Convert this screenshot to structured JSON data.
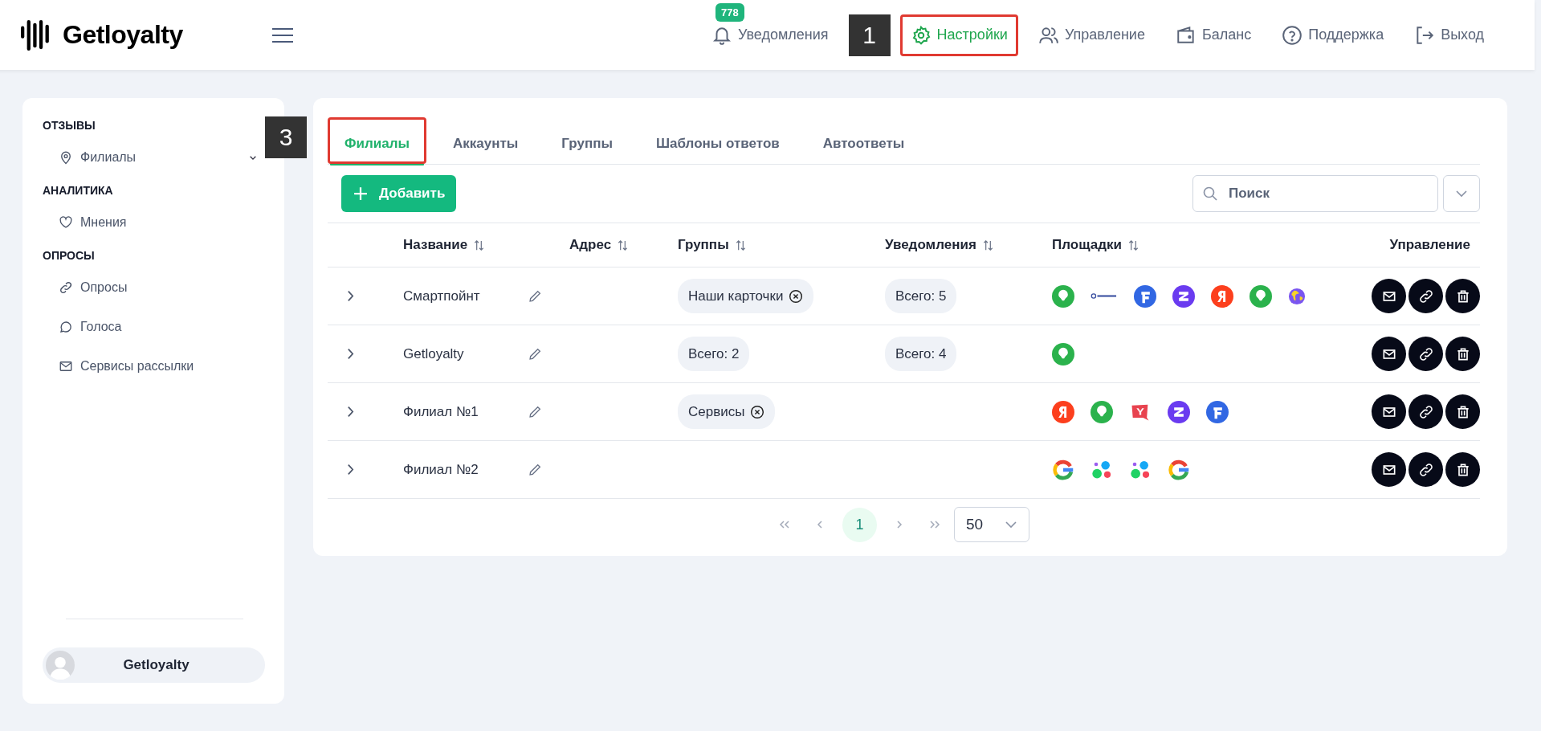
{
  "header": {
    "logo": "Getloyalty",
    "notifications": {
      "label": "Уведомления",
      "count": "778"
    },
    "annotation": "1",
    "nav": [
      {
        "label": "Настройки",
        "kind": "gear",
        "selected": true,
        "highlighted": true
      },
      {
        "label": "Управление",
        "kind": "users",
        "selected": false,
        "highlighted": false
      },
      {
        "label": "Баланс",
        "kind": "wallet",
        "selected": false,
        "highlighted": false
      },
      {
        "label": "Поддержка",
        "kind": "help",
        "selected": false,
        "highlighted": false
      },
      {
        "label": "Выход",
        "kind": "exit",
        "selected": false,
        "highlighted": false
      }
    ]
  },
  "sidebar": {
    "sections": [
      {
        "title": "ОТЗЫВЫ",
        "items": [
          {
            "label": "Филиалы",
            "kind": "pin",
            "expandable": true
          }
        ]
      },
      {
        "title": "АНАЛИТИКА",
        "items": [
          {
            "label": "Мнения",
            "kind": "heart",
            "expandable": false
          }
        ]
      },
      {
        "title": "ОПРОСЫ",
        "items": [
          {
            "label": "Опросы",
            "kind": "link",
            "expandable": false
          },
          {
            "label": "Голоса",
            "kind": "chat",
            "expandable": false
          },
          {
            "label": "Сервисы рассылки",
            "kind": "mail",
            "expandable": false
          }
        ]
      }
    ],
    "user": {
      "name": "Getloyalty"
    }
  },
  "tabs_annotation": "3",
  "tabs": [
    {
      "label": "Филиалы",
      "selected": true,
      "highlighted": true
    },
    {
      "label": "Аккаунты",
      "selected": false,
      "highlighted": false
    },
    {
      "label": "Группы",
      "selected": false,
      "highlighted": false
    },
    {
      "label": "Шаблоны ответов",
      "selected": false,
      "highlighted": false
    },
    {
      "label": "Автоответы",
      "selected": false,
      "highlighted": false
    }
  ],
  "toolbar": {
    "add_button": "Добавить",
    "search": {
      "placeholder": "Поиск"
    }
  },
  "table": {
    "columns": [
      {
        "label": "Название",
        "sortable": true
      },
      {
        "label": "Адрес",
        "sortable": true
      },
      {
        "label": "Группы",
        "sortable": true
      },
      {
        "label": "Уведомления",
        "sortable": true
      },
      {
        "label": "Площадки",
        "sortable": true
      },
      {
        "label": "Управление",
        "sortable": false
      }
    ],
    "rows": [
      {
        "name": "Смартпойнт",
        "groups": [
          {
            "label": "Наши карточки",
            "removable": true
          }
        ],
        "notifications": "Всего: 5",
        "platforms": [
          {
            "kind": "green-pin"
          },
          {
            "kind": "wordmark"
          },
          {
            "kind": "blue-f"
          },
          {
            "kind": "purple-z"
          },
          {
            "kind": "red-ya"
          },
          {
            "kind": "green-pin"
          },
          {
            "kind": "globe"
          }
        ]
      },
      {
        "name": "Getloyalty",
        "groups": [
          {
            "label": "Всего: 2",
            "removable": false
          }
        ],
        "notifications": "Всего: 4",
        "platforms": [
          {
            "kind": "green-pin"
          }
        ]
      },
      {
        "name": "Филиал №1",
        "groups": [
          {
            "label": "Сервисы",
            "removable": true
          }
        ],
        "platforms": [
          {
            "kind": "red-ya"
          },
          {
            "kind": "green-pin"
          },
          {
            "kind": "red-y"
          },
          {
            "kind": "purple-z"
          },
          {
            "kind": "blue-f"
          }
        ]
      },
      {
        "name": "Филиал №2",
        "groups": [],
        "platforms": [
          {
            "kind": "google"
          },
          {
            "kind": "dots"
          },
          {
            "kind": "dots"
          },
          {
            "kind": "google"
          }
        ]
      }
    ]
  },
  "pagination": {
    "pages": [
      {
        "label": "1",
        "selected": true
      }
    ],
    "page_size": "50"
  }
}
